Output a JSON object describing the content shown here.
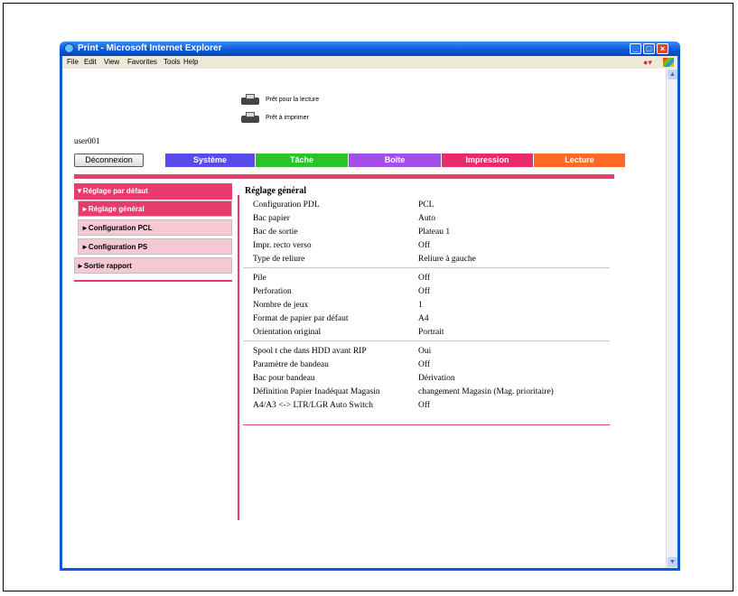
{
  "window": {
    "title": "Print - Microsoft Internet Explorer",
    "menu": [
      "File",
      "Edit",
      "View",
      "Favorites",
      "Tools",
      "Help"
    ]
  },
  "status": {
    "ready_read": "Prêt pour la lecture",
    "ready_print": "Prêt à imprimer"
  },
  "user": "user001",
  "logout_label": "Déconnexion",
  "tabs": [
    {
      "label": "Système",
      "color": "#5a4be8"
    },
    {
      "label": "Tâche",
      "color": "#2bc22b"
    },
    {
      "label": "Boîte",
      "color": "#a64ee8"
    },
    {
      "label": "Impression",
      "color": "#e82a6e"
    },
    {
      "label": "Lecture",
      "color": "#ff6a2a"
    }
  ],
  "sidebar": {
    "items": [
      {
        "label": "▼Réglage par défaut",
        "state": "active"
      },
      {
        "label": "►Réglage général",
        "state": "active"
      },
      {
        "label": "►Configuration PCL",
        "state": "normal"
      },
      {
        "label": "►Configuration PS",
        "state": "normal"
      },
      {
        "label": "►Sortie rapport",
        "state": "normal"
      }
    ]
  },
  "content": {
    "heading": "Réglage général",
    "groups": [
      [
        {
          "key": "Configuration PDL",
          "value": "PCL"
        },
        {
          "key": "Bac papier",
          "value": "Auto"
        },
        {
          "key": "Bac de sortie",
          "value": "Plateau 1"
        },
        {
          "key": "Impr. recto verso",
          "value": "Off"
        },
        {
          "key": "Type de reliure",
          "value": "Reliure à gauche"
        }
      ],
      [
        {
          "key": "Pile",
          "value": "Off"
        },
        {
          "key": "Perforation",
          "value": "Off"
        },
        {
          "key": "Nombre de jeux",
          "value": "1"
        },
        {
          "key": "Format de papier par défaut",
          "value": "A4"
        },
        {
          "key": "Orientation original",
          "value": "Portrait"
        }
      ],
      [
        {
          "key": "Spool t che dans HDD avant RIP",
          "value": "Oui"
        },
        {
          "key": "Paramètre de bandeau",
          "value": "Off"
        },
        {
          "key": "Bac pour bandeau",
          "value": "Dérivation"
        },
        {
          "key": "Définition Papier Inadéquat Magasin",
          "value": "changement Magasin (Mag. prioritaire)"
        },
        {
          "key": "A4/A3 <-> LTR/LGR Auto Switch",
          "value": "Off"
        }
      ]
    ]
  }
}
